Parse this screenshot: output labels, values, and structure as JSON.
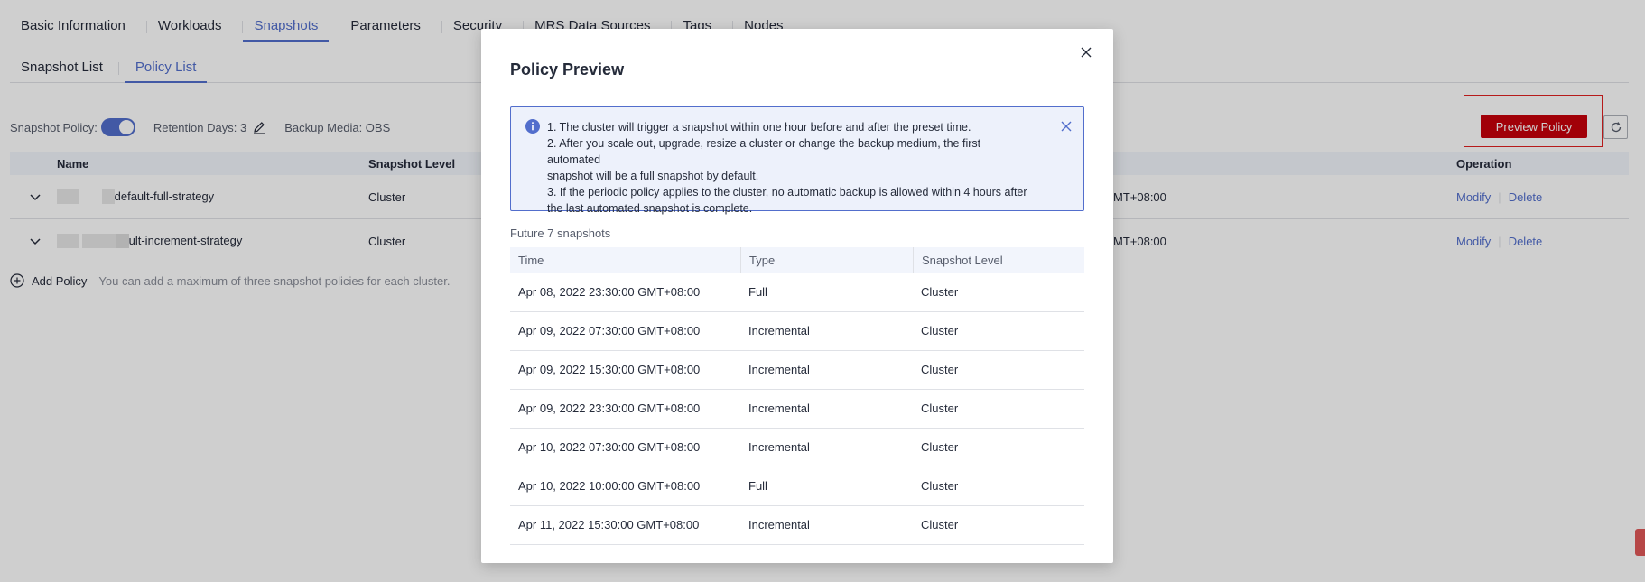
{
  "tabs": [
    "Basic Information",
    "Workloads",
    "Snapshots",
    "Parameters",
    "Security",
    "MRS Data Sources",
    "Tags",
    "Nodes"
  ],
  "subtabs": [
    "Snapshot List",
    "Policy List"
  ],
  "policy_bar": {
    "snapshot_policy_label": "Snapshot Policy:",
    "retention_label": "Retention Days: 3",
    "backup_media_label": "Backup Media: OBS"
  },
  "preview_button": "Preview Policy",
  "table": {
    "headers": {
      "name": "Name",
      "level": "Snapshot Level",
      "op": "Operation"
    },
    "rows": [
      {
        "name": "default-full-strategy",
        "level": "Cluster",
        "time": "MT+08:00",
        "modify": "Modify",
        "delete": "Delete"
      },
      {
        "name": "ult-increment-strategy",
        "level": "Cluster",
        "time": "MT+08:00",
        "modify": "Modify",
        "delete": "Delete"
      }
    ]
  },
  "add_policy": {
    "label": "Add Policy",
    "tip": "You can add a maximum of three snapshot policies for each cluster."
  },
  "modal": {
    "title": "Policy Preview",
    "notice": [
      "1. The cluster will trigger a snapshot within one hour before and after the preset time.",
      "2. After you scale out, upgrade, resize a cluster or change the backup medium, the first automated",
      "snapshot will be a full snapshot by default.",
      "3. If the periodic policy applies to the cluster, no automatic backup is allowed within 4 hours after",
      "the last automated snapshot is complete."
    ],
    "future_label": "Future 7 snapshots",
    "columns": [
      "Time",
      "Type",
      "Snapshot Level"
    ],
    "rows": [
      {
        "time": "Apr 08, 2022 23:30:00 GMT+08:00",
        "type": "Full",
        "level": "Cluster"
      },
      {
        "time": "Apr 09, 2022 07:30:00 GMT+08:00",
        "type": "Incremental",
        "level": "Cluster"
      },
      {
        "time": "Apr 09, 2022 15:30:00 GMT+08:00",
        "type": "Incremental",
        "level": "Cluster"
      },
      {
        "time": "Apr 09, 2022 23:30:00 GMT+08:00",
        "type": "Incremental",
        "level": "Cluster"
      },
      {
        "time": "Apr 10, 2022 07:30:00 GMT+08:00",
        "type": "Incremental",
        "level": "Cluster"
      },
      {
        "time": "Apr 10, 2022 10:00:00 GMT+08:00",
        "type": "Full",
        "level": "Cluster"
      },
      {
        "time": "Apr 11, 2022 15:30:00 GMT+08:00",
        "type": "Incremental",
        "level": "Cluster"
      }
    ]
  },
  "colors": {
    "accent": "#526ecc",
    "primary_button": "#c7000b",
    "highlight": "#e02020"
  }
}
